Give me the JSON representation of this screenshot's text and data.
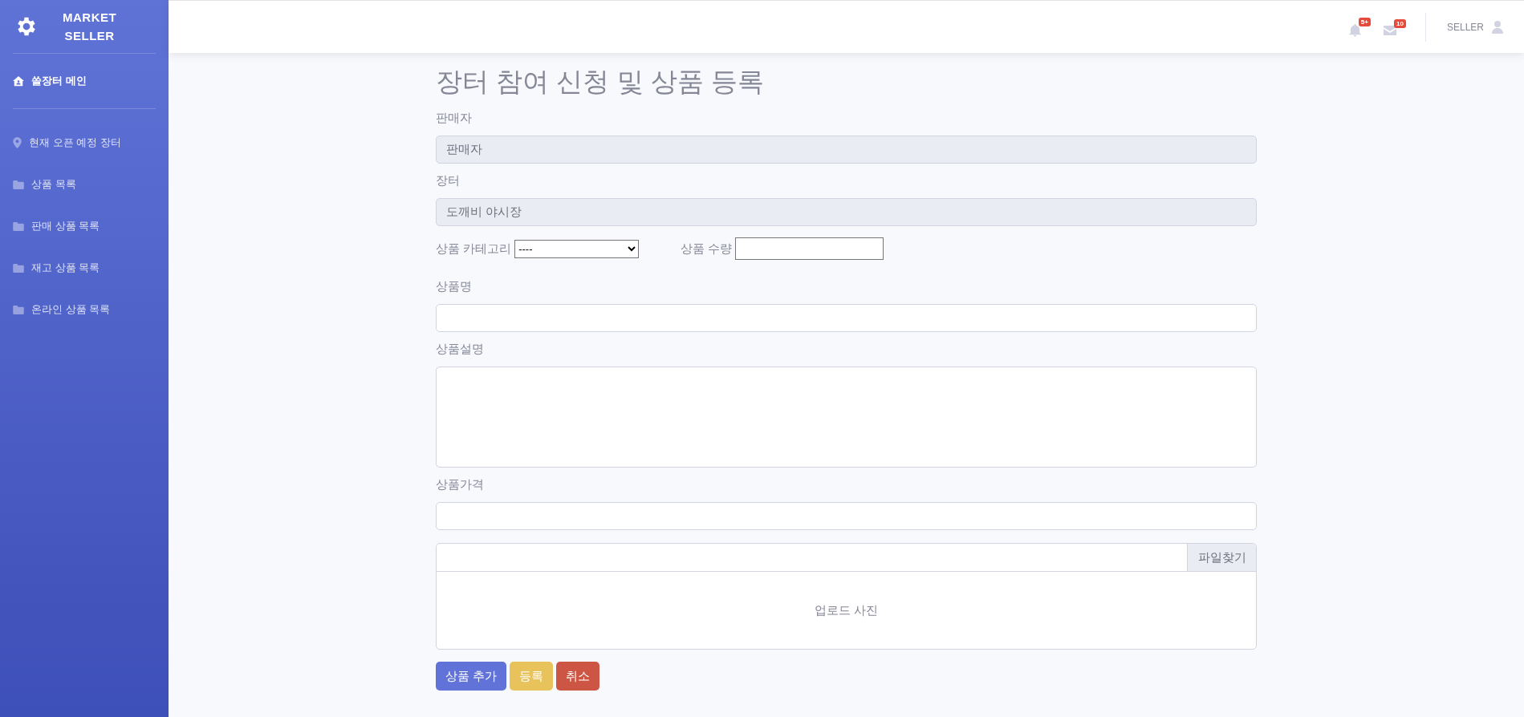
{
  "sidebar": {
    "brand": [
      "MARKET",
      "SELLER"
    ],
    "items": [
      {
        "label": "쏠장터 메인",
        "kind": "home",
        "selected": true
      },
      {
        "label": "현재 오픈 예정 장터",
        "kind": "pin",
        "selected": false
      },
      {
        "label": "상품 목록",
        "kind": "folder",
        "selected": false
      },
      {
        "label": "판매 상품 목록",
        "kind": "folder",
        "selected": false
      },
      {
        "label": "재고 상품 목록",
        "kind": "folder",
        "selected": false
      },
      {
        "label": "온라인 상품 목록",
        "kind": "folder",
        "selected": false
      }
    ]
  },
  "topbar": {
    "alerts_badge": "5+",
    "messages_badge": "10",
    "user": "SELLER"
  },
  "form": {
    "title": "장터 참여 신청 및 상품 등록",
    "seller_label": "판매자",
    "seller_value": "판매자",
    "market_label": "장터",
    "market_value": "도깨비 야시장",
    "category_label": "상품 카테고리",
    "category_value": "----",
    "quantity_label": "상품 수량",
    "name_label": "상품명",
    "description_label": "상품설명",
    "price_label": "상품가격",
    "file_button": "파일찾기",
    "upload_text": "업로드 사진",
    "buttons": [
      {
        "label": "상품 추가",
        "kind": "primary"
      },
      {
        "label": "등록",
        "kind": "warning"
      },
      {
        "label": "취소",
        "kind": "danger"
      }
    ]
  }
}
